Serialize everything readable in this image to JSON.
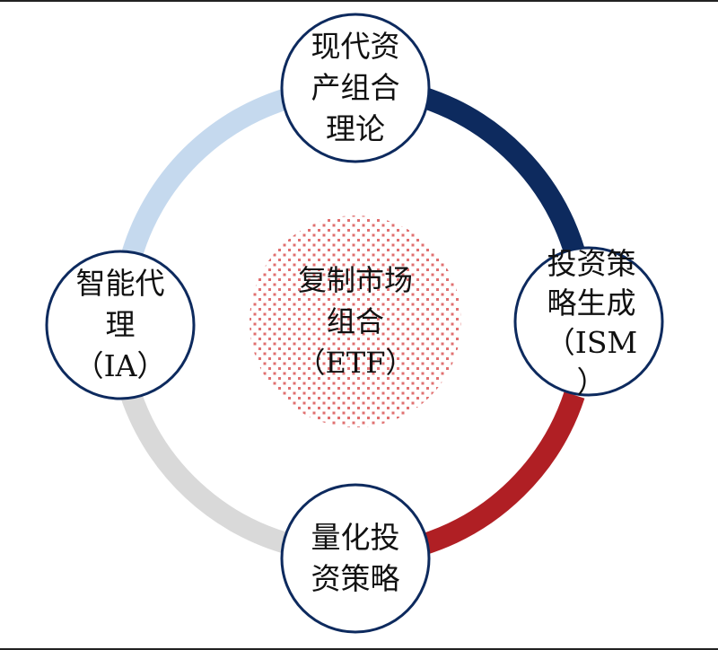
{
  "colors": {
    "arc_top_right": "#0d2a5e",
    "arc_bottom_right": "#b01f24",
    "arc_bottom_left": "#d9d9d9",
    "arc_top_left": "#c5d9ee",
    "node_border": "#0d2a5e",
    "center_dots": "#e07070"
  },
  "nodes": {
    "top": "现代资\n产组合\n理论",
    "right": "投资策\n略生成\n（ISM\n）",
    "bottom": "量化投\n资策略",
    "left": "智能代\n理\n（IA）"
  },
  "center": "复制市场\n组合\n（ETF）"
}
